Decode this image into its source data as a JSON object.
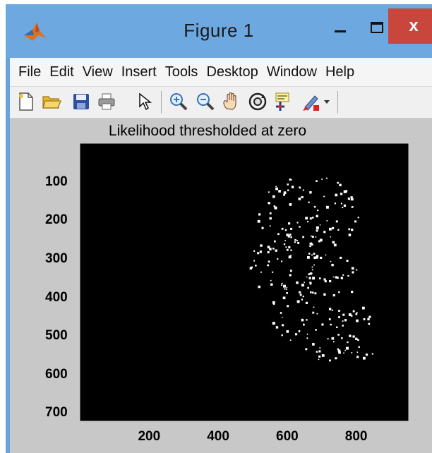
{
  "window": {
    "title": "Figure 1",
    "close_glyph": "x",
    "titlebar_color": "#6ea8e0",
    "close_color": "#c8463c"
  },
  "menubar": {
    "items": [
      "File",
      "Edit",
      "View",
      "Insert",
      "Tools",
      "Desktop",
      "Window",
      "Help"
    ]
  },
  "toolbar": {
    "icons": [
      "new-figure-icon",
      "open-file-icon",
      "save-icon",
      "print-icon",
      "pointer-icon",
      "zoom-in-icon",
      "zoom-out-icon",
      "pan-hand-icon",
      "rotate-3d-icon",
      "data-cursor-icon",
      "brush-icon",
      "dropdown-arrow-icon"
    ]
  },
  "chart_data": {
    "type": "heatmap",
    "title": "Likelihood thresholded at zero",
    "xlabel": "",
    "ylabel": "",
    "xticks": [
      200,
      400,
      600,
      800
    ],
    "yticks": [
      100,
      200,
      300,
      400,
      500,
      600,
      700
    ],
    "xlim": [
      1,
      950
    ],
    "ylim": [
      1,
      720
    ],
    "yaxis_direction": "reverse",
    "colormap": [
      "#000000",
      "#ffffff"
    ],
    "values": "binary mask: white where likelihood > 0, black elsewhere"
  }
}
